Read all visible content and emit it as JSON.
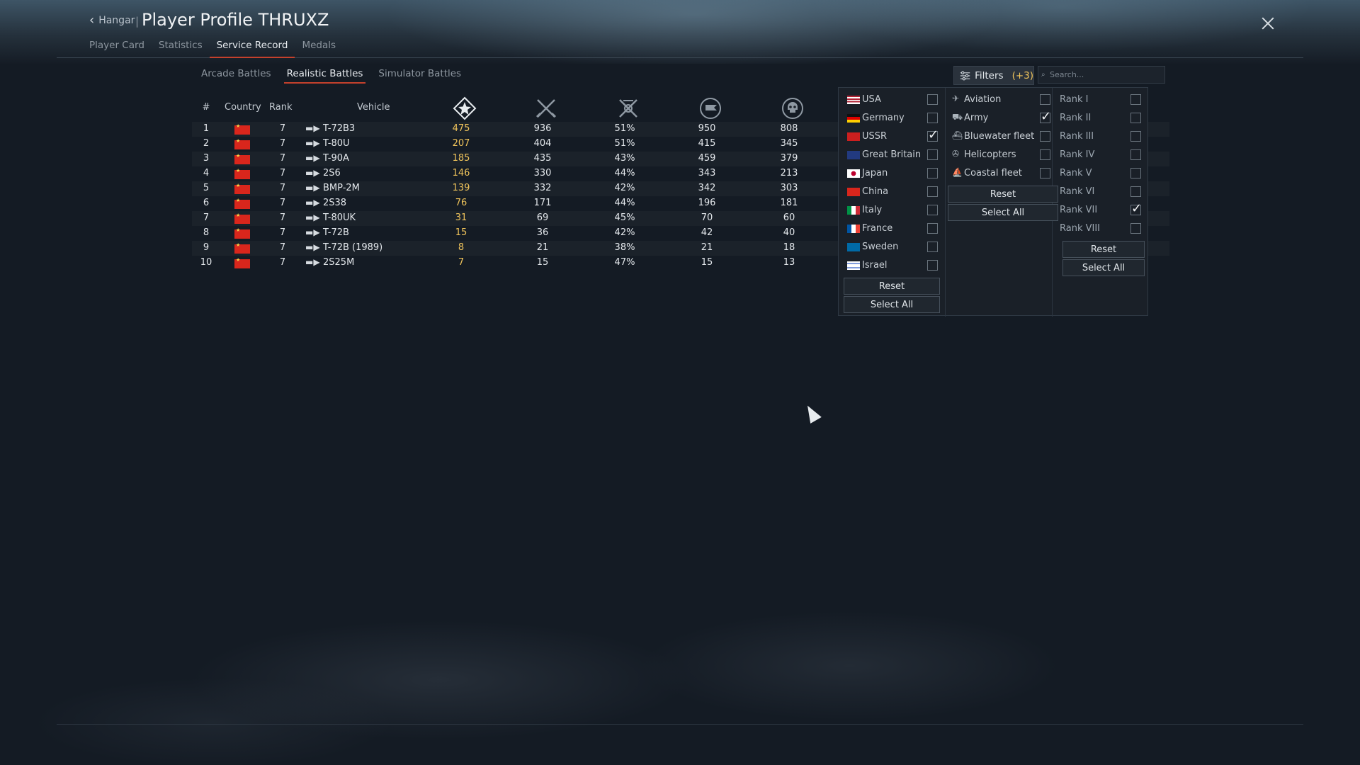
{
  "header": {
    "back_label": "Hangar",
    "separator": "|",
    "title": "Player Profile THRUXZ"
  },
  "nav": {
    "tabs": [
      {
        "label": "Player Card",
        "active": false
      },
      {
        "label": "Statistics",
        "active": false
      },
      {
        "label": "Service Record",
        "active": true
      },
      {
        "label": "Medals",
        "active": false
      }
    ]
  },
  "modes": {
    "tabs": [
      {
        "label": "Arcade Battles",
        "active": false
      },
      {
        "label": "Realistic Battles",
        "active": true
      },
      {
        "label": "Simulator Battles",
        "active": false
      }
    ]
  },
  "table": {
    "headers": {
      "num": "#",
      "country": "Country",
      "rank": "Rank",
      "vehicle": "Vehicle"
    },
    "stat_icons": [
      "battles-icon",
      "kills-icon",
      "win-rate-icon",
      "capture-icon",
      "deaths-icon"
    ],
    "rows": [
      {
        "num": "1",
        "rank": "7",
        "vehicle": "T-72B3",
        "v1": "475",
        "v2": "936",
        "v3": "51%",
        "v4": "950",
        "v5": "808"
      },
      {
        "num": "2",
        "rank": "7",
        "vehicle": "T-80U",
        "v1": "207",
        "v2": "404",
        "v3": "51%",
        "v4": "415",
        "v5": "345"
      },
      {
        "num": "3",
        "rank": "7",
        "vehicle": "T-90A",
        "v1": "185",
        "v2": "435",
        "v3": "43%",
        "v4": "459",
        "v5": "379"
      },
      {
        "num": "4",
        "rank": "7",
        "vehicle": "2S6",
        "v1": "146",
        "v2": "330",
        "v3": "44%",
        "v4": "343",
        "v5": "213"
      },
      {
        "num": "5",
        "rank": "7",
        "vehicle": "BMP-2M",
        "v1": "139",
        "v2": "332",
        "v3": "42%",
        "v4": "342",
        "v5": "303"
      },
      {
        "num": "6",
        "rank": "7",
        "vehicle": "2S38",
        "v1": "76",
        "v2": "171",
        "v3": "44%",
        "v4": "196",
        "v5": "181"
      },
      {
        "num": "7",
        "rank": "7",
        "vehicle": "T-80UK",
        "v1": "31",
        "v2": "69",
        "v3": "45%",
        "v4": "70",
        "v5": "60"
      },
      {
        "num": "8",
        "rank": "7",
        "vehicle": "T-72B",
        "v1": "15",
        "v2": "36",
        "v3": "42%",
        "v4": "42",
        "v5": "40"
      },
      {
        "num": "9",
        "rank": "7",
        "vehicle": "T-72B (1989)",
        "v1": "8",
        "v2": "21",
        "v3": "38%",
        "v4": "21",
        "v5": "18"
      },
      {
        "num": "10",
        "rank": "7",
        "vehicle": "2S25M",
        "v1": "7",
        "v2": "15",
        "v3": "47%",
        "v4": "15",
        "v5": "13"
      }
    ]
  },
  "filters": {
    "button_label": "Filters",
    "count": "(+3)",
    "search_placeholder": "Search...",
    "countries": [
      {
        "label": "USA",
        "checked": false
      },
      {
        "label": "Germany",
        "checked": false
      },
      {
        "label": "USSR",
        "checked": true
      },
      {
        "label": "Great Britain",
        "checked": false
      },
      {
        "label": "Japan",
        "checked": false
      },
      {
        "label": "China",
        "checked": false
      },
      {
        "label": "Italy",
        "checked": false
      },
      {
        "label": "France",
        "checked": false
      },
      {
        "label": "Sweden",
        "checked": false
      },
      {
        "label": "Israel",
        "checked": false
      }
    ],
    "types": [
      {
        "label": "Aviation",
        "checked": false
      },
      {
        "label": "Army",
        "checked": true
      },
      {
        "label": "Bluewater fleet",
        "checked": false
      },
      {
        "label": "Helicopters",
        "checked": false
      },
      {
        "label": "Coastal fleet",
        "checked": false
      }
    ],
    "ranks": [
      {
        "label": "Rank I",
        "checked": false
      },
      {
        "label": "Rank II",
        "checked": false
      },
      {
        "label": "Rank III",
        "checked": false
      },
      {
        "label": "Rank IV",
        "checked": false
      },
      {
        "label": "Rank V",
        "checked": false
      },
      {
        "label": "Rank VI",
        "checked": false
      },
      {
        "label": "Rank VII",
        "checked": true
      },
      {
        "label": "Rank VIII",
        "checked": false
      }
    ],
    "reset_label": "Reset",
    "select_all_label": "Select All"
  },
  "colors": {
    "accent_tab_underline": "#c4412c",
    "battles_highlight": "#f0c45b",
    "china_flag": "#d9261c"
  }
}
